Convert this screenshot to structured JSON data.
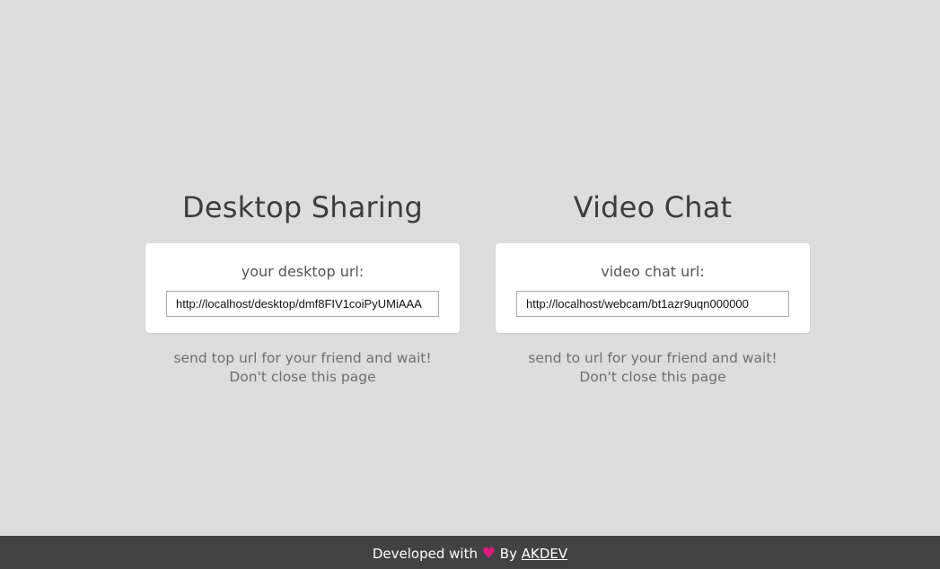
{
  "desktop_sharing": {
    "title": "Desktop Sharing",
    "label": "your desktop url:",
    "url": "http://localhost/desktop/dmf8FIV1coiPyUMiAAA",
    "hint_line1": "send top url for your friend and wait!",
    "hint_line2": "Don't close this page"
  },
  "video_chat": {
    "title": "Video Chat",
    "label": "video chat url:",
    "url": "http://localhost/webcam/bt1azr9uqn000000",
    "hint_line1": "send to url for your friend and wait!",
    "hint_line2": "Don't close this page"
  },
  "footer": {
    "prefix": "Developed with",
    "heart_icon": "heart-icon",
    "heart_glyph": "♥",
    "by": "By",
    "author_link": "AKDEV",
    "heart_color": "#e0197d",
    "background": "#424242"
  }
}
